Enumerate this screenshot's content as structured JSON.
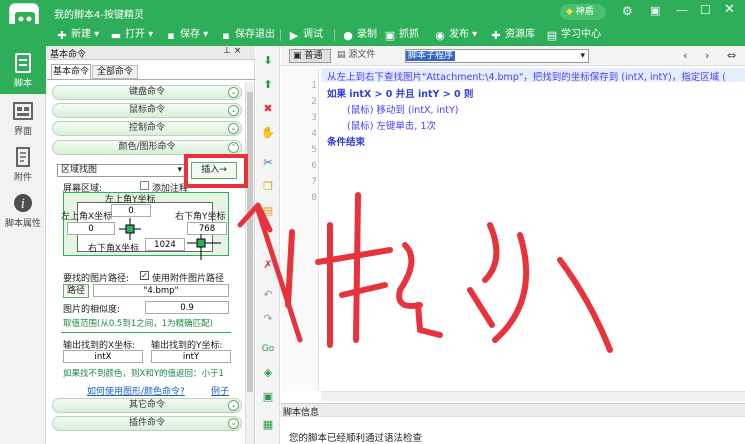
{
  "window": {
    "title": "我的脚本4-按键精灵",
    "user_button": "神盾"
  },
  "toolbar": {
    "new": "新建",
    "open": "打开",
    "save": "保存",
    "save_exit": "保存退出",
    "debug": "调试",
    "record": "录制",
    "capture": "抓抓",
    "publish": "发布",
    "resources": "资源库",
    "learning": "学习中心"
  },
  "leftnav": [
    "脚本",
    "界面",
    "附件",
    "脚本属性"
  ],
  "panel": {
    "header": "基本命令",
    "pin": "⊥  ×",
    "tabs": [
      "基本命令",
      "全部命令"
    ],
    "categories": [
      "键盘命令",
      "鼠标命令",
      "控制命令",
      "颜色/图形命令"
    ],
    "bottom_categories": [
      "其它命令",
      "插件命令"
    ],
    "command_select": "区域找图",
    "insert_button": "插入→",
    "screen_area_label": "屏幕区域:",
    "add_comment_label": "添加注释",
    "top_left_y_label": "左上角Y坐标",
    "top_left_y": "0",
    "top_left_x_label": "左上角X坐标",
    "top_left_x": "0",
    "bottom_right_y_label": "右下角Y坐标",
    "bottom_right_y": "768",
    "bottom_right_x_label": "右下角X坐标",
    "bottom_right_x": "1024",
    "image_path_label": "要找的图片路径:",
    "use_attachment_label": "使用附件图片路径",
    "path_button": "路径",
    "path_value": "\"4.bmp\"",
    "similarity_label": "图片的相似度:",
    "similarity_value": "0.9",
    "similarity_hint": "取值范围(从0.5到1之间，1为精确匹配)",
    "out_x_label": "输出找到的X坐标:",
    "out_x": "intX",
    "out_y_label": "输出找到的Y坐标:",
    "out_y": "intY",
    "not_found_hint": "如果找不到颜色，则X和Y的值返回：小于1",
    "help_link": "如何使用图形/颜色命令?",
    "example_link": "例子"
  },
  "editor": {
    "mode_normal": "普通",
    "mode_source": "源文件",
    "sub_select": "脚本子程序",
    "lines": [
      "从左上到右下查找图片\"Attachment:\\4.bmp\"，把找到的坐标保存到 (intX, intY)，指定区域 (",
      "如果 intX > 0 并且 intY > 0 则",
      "(鼠标) 移动到 (intX, intY)",
      "(鼠标) 左键单击, 1次",
      "条件结束"
    ],
    "line_numbers": [
      "1",
      "2",
      "3",
      "4",
      "5",
      "6",
      "7",
      "8"
    ],
    "info_header": "脚本信息",
    "info_text": "您的脚本已经顺利通过语法检查"
  },
  "annotation": {
    "handwriting": "插入",
    "color": "#e8323c"
  },
  "colors": {
    "brand": "#2eae59",
    "annotation": "#e8323c",
    "code_blue": "#2f3fd0",
    "code_comment": "#4040ff"
  }
}
